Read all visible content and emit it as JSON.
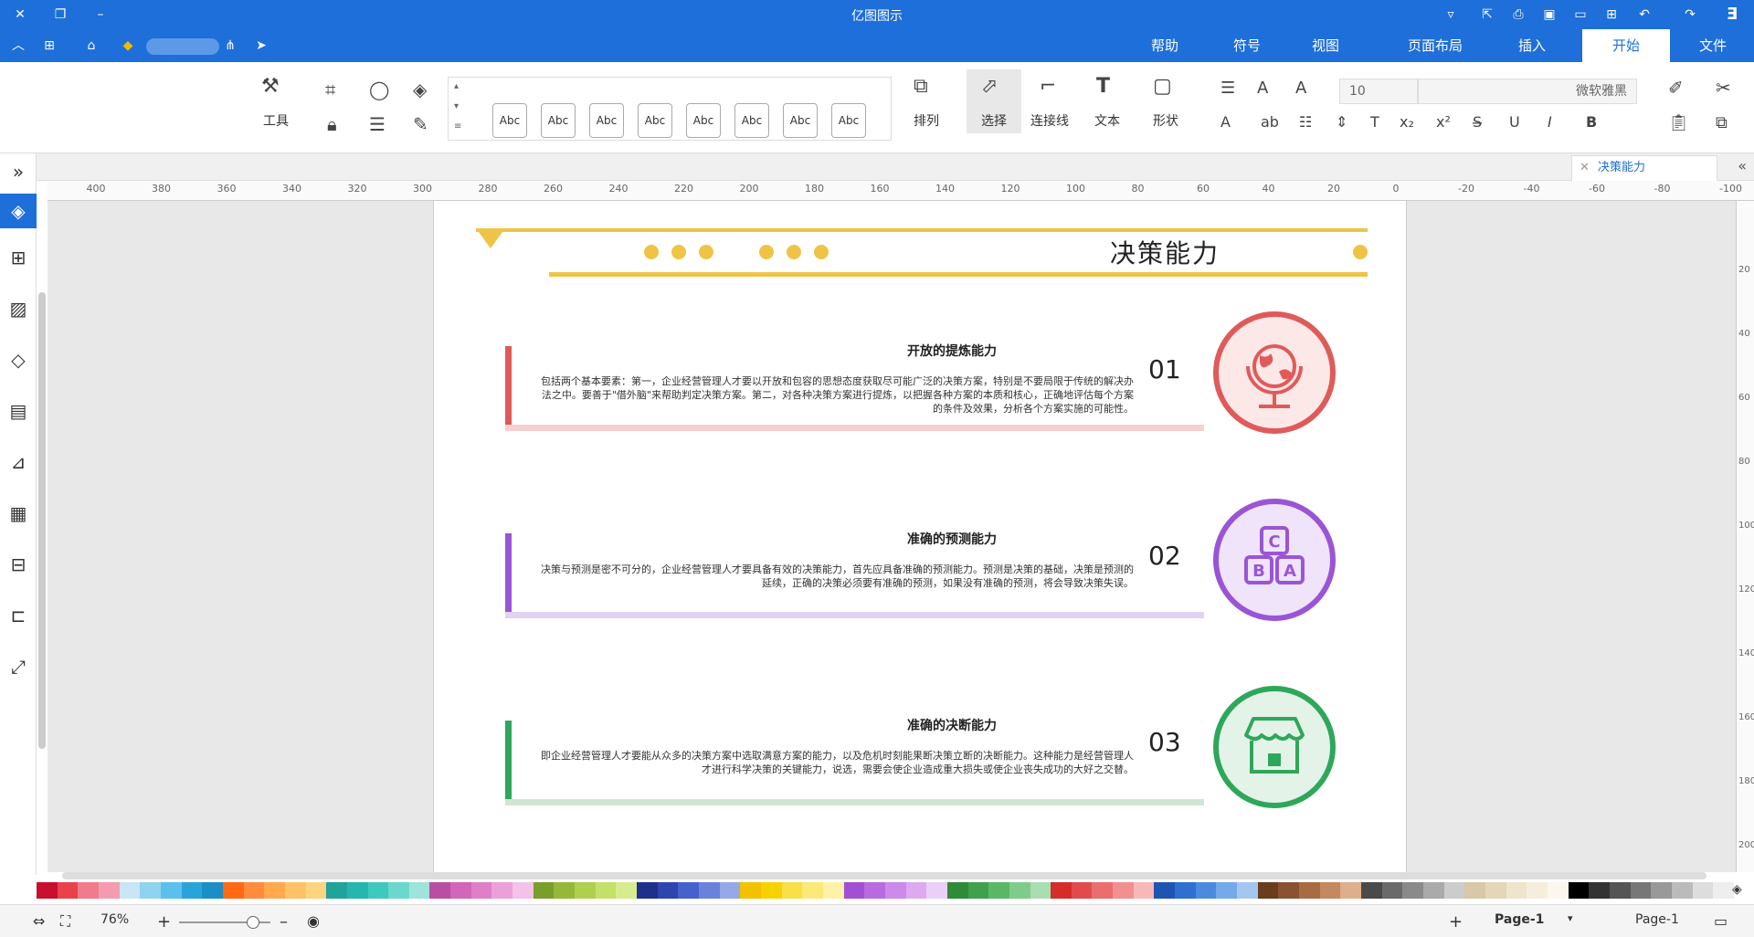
{
  "app": {
    "title": "亿图图示"
  },
  "menu": {
    "items": [
      "文件",
      "开始",
      "插入",
      "页面布局",
      "视图",
      "符号",
      "帮助"
    ],
    "active": "开始"
  },
  "ribbon": {
    "font_name": "微软雅黑",
    "font_size": "10",
    "style_label": "Abc",
    "tools": {
      "shape": "形状",
      "text": "文本",
      "connector": "连接线",
      "select": "选择",
      "arrange": "排列",
      "tools": "工具"
    }
  },
  "tab": {
    "name": "决策能力"
  },
  "ruler": {
    "marks": [
      "-100",
      "-80",
      "-60",
      "-40",
      "-20",
      "0",
      "20",
      "40",
      "60",
      "80",
      "100",
      "120",
      "140",
      "160",
      "180",
      "200",
      "220",
      "240",
      "260",
      "280",
      "300",
      "320",
      "340",
      "360",
      "380",
      "400"
    ],
    "vmarks": [
      "20",
      "40",
      "60",
      "80",
      "100",
      "120",
      "140",
      "160",
      "180",
      "200"
    ]
  },
  "diagram": {
    "title": "决策能力",
    "cards": [
      {
        "num": "01",
        "title": "开放的提炼能力",
        "text": "包括两个基本要素：第一，企业经营管理人才要以开放和包容的思想态度获取尽可能广泛的决策方案，特别是不要局限于传统的解决办法之中。要善于\"借外脑\"来帮助判定决策方案。第二，对各种决策方案进行提炼，以把握各种方案的本质和核心，正确地评估每个方案的条件及效果，分析各个方案实施的可能性。",
        "color": "#e05a5a",
        "line_color": "#f6cfcf",
        "icon": "globe-icon"
      },
      {
        "num": "02",
        "title": "准确的预测能力",
        "text": "决策与预测是密不可分的，企业经营管理人才要具备有效的决策能力，首先应具备准确的预测能力。预测是决策的基础，决策是预测的延续，正确的决策必须要有准确的预测，如果没有准确的预测，将会导致决策失误。",
        "color": "#9a55d6",
        "line_color": "#e3d3f3",
        "icon": "abc-blocks-icon"
      },
      {
        "num": "03",
        "title": "准确的决断能力",
        "text": "即企业经营管理人才要能从众多的决策方案中选取满意方案的能力，以及危机时刻能果断决策立断的决断能力。这种能力是经营管理人才进行科学决策的关键能力，说选，需要会使企业造成重大损失或使企业丧失成功的大好之交替。",
        "color": "#2ea75a",
        "line_color": "#cfe6d6",
        "icon": "store-icon"
      }
    ]
  },
  "status": {
    "page_tab": "Page-1",
    "page_tab2": "Page-1",
    "zoom": "76%"
  },
  "palette": [
    "#c8102e",
    "#e8434a",
    "#f07b8a",
    "#f59bb0",
    "#c8e6f5",
    "#8fd3f0",
    "#5bc0eb",
    "#2aa4d8",
    "#1b8ec7",
    "#ff6a13",
    "#ff8b3d",
    "#ffa94d",
    "#ffc266",
    "#ffd480",
    "#1fa39b",
    "#25b7ae",
    "#3fc9bd",
    "#6ad8cd",
    "#9fe4dc",
    "#b84fa0",
    "#d266b8",
    "#e07fc8",
    "#eca0da",
    "#f4c2e8",
    "#7a9e2c",
    "#95b83a",
    "#aed04e",
    "#c5e06a",
    "#d8ec8f",
    "#1f2f8c",
    "#2e45b0",
    "#4661cc",
    "#6b82dd",
    "#97a8e8",
    "#f2c200",
    "#f6d300",
    "#f9e04a",
    "#fbe97a",
    "#fdf2a8",
    "#a24fd6",
    "#b86be0",
    "#cc8aea",
    "#dcaaf0",
    "#ead0f6",
    "#2e8b3a",
    "#3ea14b",
    "#58b866",
    "#7fcc8a",
    "#a9deb1",
    "#d62b2b",
    "#e24b4b",
    "#ec6d6d",
    "#f29090",
    "#f8b8b8",
    "#1e55b3",
    "#2f6fd0",
    "#4a8be0",
    "#74a9ea",
    "#a4c7f2",
    "#6a3d1e",
    "#8a5230",
    "#a86c45",
    "#c4895f",
    "#dfae8a",
    "#4a4a4a",
    "#6a6a6a",
    "#8a8a8a",
    "#aaaaaa",
    "#cccccc",
    "#d8c8a8",
    "#e4d6b8",
    "#efe4cc",
    "#f6eedc",
    "#fbf7ee",
    "#000000",
    "#333333",
    "#555555",
    "#777777",
    "#999999",
    "#bbbbbb",
    "#dddddd",
    "#eeeeee",
    "#ffffff"
  ]
}
